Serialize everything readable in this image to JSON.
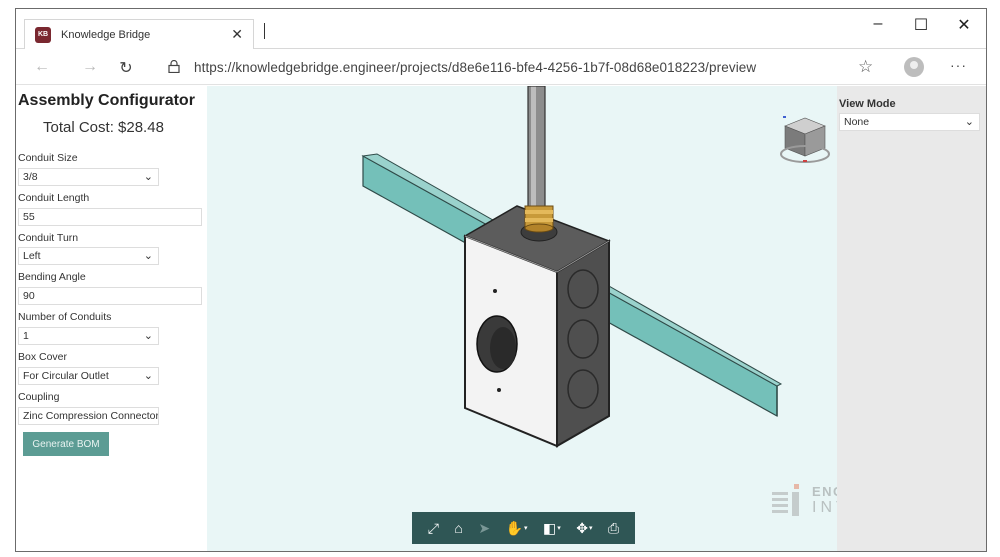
{
  "browser": {
    "tab_title": "Knowledge Bridge",
    "favicon_text": "KB",
    "url": "https://knowledgebridge.engineer/projects/d8e6e116-bfe4-4256-1b7f-08d68e018223/preview",
    "window_buttons": [
      "–",
      "☐",
      "✕"
    ]
  },
  "configurator": {
    "title": "Assembly Configurator",
    "total_cost": "Total Cost: $28.48",
    "fields": [
      {
        "label": "Conduit Size",
        "value": "3/8",
        "type": "select"
      },
      {
        "label": "Conduit Length",
        "value": "55",
        "type": "text"
      },
      {
        "label": "Conduit Turn",
        "value": "Left",
        "type": "select"
      },
      {
        "label": "Bending Angle",
        "value": "90",
        "type": "text"
      },
      {
        "label": "Number of Conduits",
        "value": "1",
        "type": "select"
      },
      {
        "label": "Box Cover",
        "value": "For Circular Outlet",
        "type": "select"
      },
      {
        "label": "Coupling",
        "value": "Zinc Compression Connector",
        "type": "select"
      }
    ],
    "bom_button": "Generate BOM"
  },
  "view_mode": {
    "label": "View Mode",
    "value": "None"
  },
  "toolbar": {
    "icons": [
      "fit-to-view-icon",
      "home-icon",
      "select-cursor-icon",
      "pan-hand-icon",
      "section-icon",
      "explode-icon",
      "properties-icon"
    ]
  },
  "watermark": {
    "line1": "ENGINEERING",
    "line2": "INTENT"
  },
  "colors": {
    "viewport_bg": "#e9f6f6",
    "toolbar_bg": "#2f5655",
    "button_bg": "#5c9c94",
    "strut": "#6cb9b3",
    "box": "#4a4a4a"
  }
}
